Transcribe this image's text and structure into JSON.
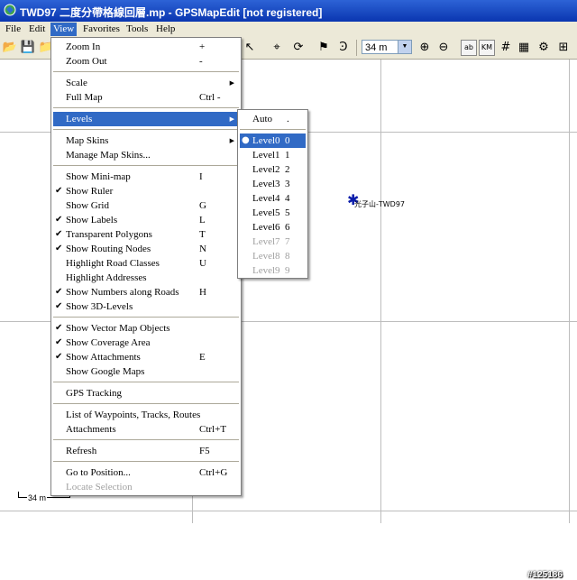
{
  "window": {
    "title": "TWD97 二度分帶格線回層.mp - GPSMapEdit [not registered]"
  },
  "menubar": {
    "items": [
      "File",
      "Edit",
      "View",
      "Favorites",
      "Tools",
      "Help"
    ],
    "active": "View"
  },
  "toolbar": {
    "zoom_value": "34 m",
    "label_ab": "ab",
    "label_km": "KM"
  },
  "map": {
    "poi_label": "光子山-TWD97",
    "scale_label": "34 m",
    "watermark": "#125186"
  },
  "view_menu": [
    {
      "label": "Zoom In",
      "shortcut": "+"
    },
    {
      "label": "Zoom Out",
      "shortcut": "-"
    },
    {
      "label": "Scale",
      "submenu": "true"
    },
    {
      "label": "Full Map",
      "shortcut": "Ctrl -"
    },
    {
      "label": "Levels",
      "submenu": "true",
      "highlight": "true"
    },
    {
      "label": "Map Skins",
      "submenu": "true"
    },
    {
      "label": "Manage Map Skins..."
    },
    {
      "label": "Show Mini-map",
      "shortcut": "I"
    },
    {
      "label": "Show Ruler",
      "checked": "true"
    },
    {
      "label": "Show Grid",
      "shortcut": "G"
    },
    {
      "label": "Show Labels",
      "shortcut": "L",
      "checked": "true"
    },
    {
      "label": "Transparent Polygons",
      "shortcut": "T",
      "checked": "true"
    },
    {
      "label": "Show Routing Nodes",
      "shortcut": "N",
      "checked": "true"
    },
    {
      "label": "Highlight Road Classes",
      "shortcut": "U"
    },
    {
      "label": "Highlight Addresses"
    },
    {
      "label": "Show Numbers along Roads",
      "shortcut": "H",
      "checked": "true"
    },
    {
      "label": "Show 3D-Levels",
      "checked": "true"
    },
    {
      "label": "Show Vector Map Objects",
      "checked": "true"
    },
    {
      "label": "Show Coverage Area",
      "checked": "true"
    },
    {
      "label": "Show Attachments",
      "shortcut": "E",
      "checked": "true"
    },
    {
      "label": "Show Google Maps"
    },
    {
      "label": "GPS Tracking"
    },
    {
      "label": "List of Waypoints, Tracks, Routes"
    },
    {
      "label": "Attachments",
      "shortcut": "Ctrl+T"
    },
    {
      "label": "Refresh",
      "shortcut": "F5"
    },
    {
      "label": "Go to Position...",
      "shortcut": "Ctrl+G"
    },
    {
      "label": "Locate Selection",
      "disabled": "true"
    }
  ],
  "levels_menu": [
    {
      "label": "Auto",
      "shortcut": "."
    },
    {
      "label": "Level0",
      "shortcut": "0",
      "selected": "true"
    },
    {
      "label": "Level1",
      "shortcut": "1"
    },
    {
      "label": "Level2",
      "shortcut": "2"
    },
    {
      "label": "Level3",
      "shortcut": "3"
    },
    {
      "label": "Level4",
      "shortcut": "4"
    },
    {
      "label": "Level5",
      "shortcut": "5"
    },
    {
      "label": "Level6",
      "shortcut": "6"
    },
    {
      "label": "Level7",
      "shortcut": "7",
      "disabled": "true"
    },
    {
      "label": "Level8",
      "shortcut": "8",
      "disabled": "true"
    },
    {
      "label": "Level9",
      "shortcut": "9",
      "disabled": "true"
    }
  ],
  "colors": {
    "title_bar": "#0a36b0",
    "menu_highlight": "#316ac5",
    "chrome": "#ece9d8",
    "poi": "#0a1caa"
  }
}
